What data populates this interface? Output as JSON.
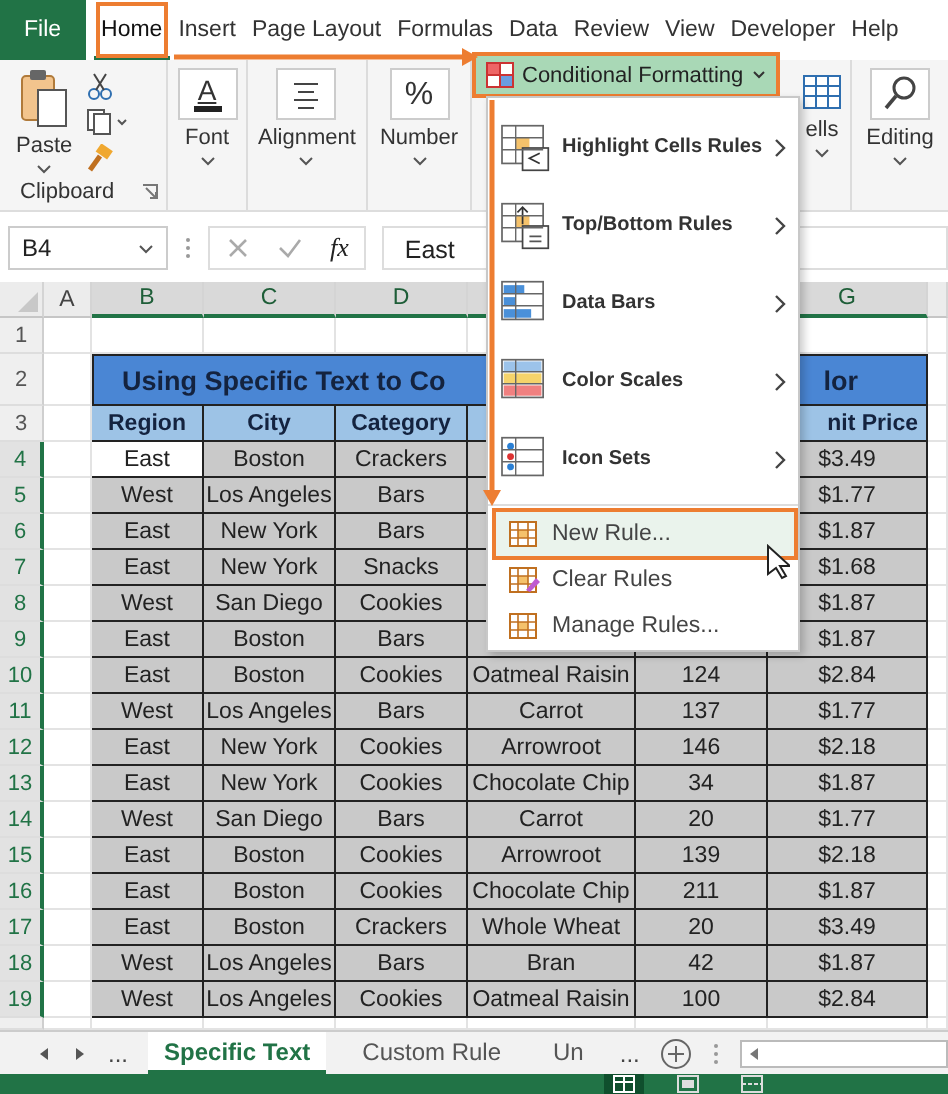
{
  "ribbon_tabs": [
    {
      "label": "File",
      "kind": "file",
      "selected": false,
      "marked": false
    },
    {
      "label": "Home",
      "kind": "tab",
      "selected": true,
      "marked": true
    },
    {
      "label": "Insert",
      "kind": "tab",
      "selected": false,
      "marked": false
    },
    {
      "label": "Page Layout",
      "kind": "tab",
      "selected": false,
      "marked": false
    },
    {
      "label": "Formulas",
      "kind": "tab",
      "selected": false,
      "marked": false
    },
    {
      "label": "Data",
      "kind": "tab",
      "selected": false,
      "marked": false
    },
    {
      "label": "Review",
      "kind": "tab",
      "selected": false,
      "marked": false
    },
    {
      "label": "View",
      "kind": "tab",
      "selected": false,
      "marked": false
    },
    {
      "label": "Developer",
      "kind": "tab",
      "selected": false,
      "marked": false
    },
    {
      "label": "Help",
      "kind": "tab",
      "selected": false,
      "marked": false
    }
  ],
  "ribbon": {
    "paste": "Paste",
    "clipboard": "Clipboard",
    "font_glyph": "A",
    "font": "Font",
    "alignment": "Alignment",
    "number_glyph": "%",
    "number": "Number",
    "conditional_formatting": {
      "label": "Conditional Formatting",
      "marked": true
    },
    "cells": "ells",
    "editing": "Editing"
  },
  "formula_bar": {
    "name_box": "B4",
    "fx": "fx",
    "value": "East"
  },
  "sheet": {
    "columns_left": [
      "A",
      "B",
      "C",
      "D"
    ],
    "columns_right": [
      "G"
    ],
    "blank_row": "1",
    "title_row": {
      "number": "2",
      "parts": [
        "Using Specific Text to Co",
        "lor"
      ]
    },
    "header_row": {
      "number": "3",
      "cells": [
        "Region",
        "City",
        "Category"
      ],
      "unit_price": "nit Price"
    },
    "rows": [
      {
        "number": "4",
        "active": true,
        "cells": [
          "East",
          "Boston",
          "Crackers"
        ],
        "unit_price": "$3.49"
      },
      {
        "number": "5",
        "active": false,
        "cells": [
          "West",
          "Los Angeles",
          "Bars"
        ],
        "unit_price": "$1.77"
      },
      {
        "number": "6",
        "active": false,
        "cells": [
          "East",
          "New York",
          "Bars"
        ],
        "unit_price": "$1.87"
      },
      {
        "number": "7",
        "active": false,
        "cells": [
          "East",
          "New York",
          "Snacks"
        ],
        "unit_price": "$1.68"
      },
      {
        "number": "8",
        "active": false,
        "cells": [
          "West",
          "San Diego",
          "Cookies"
        ],
        "unit_price": "$1.87"
      },
      {
        "number": "9",
        "active": false,
        "cells": [
          "East",
          "Boston",
          "Bars"
        ],
        "unit_price": "$1.87"
      },
      {
        "number": "10",
        "active": false,
        "cells": [
          "East",
          "Boston",
          "Cookies",
          "Oatmeal Raisin",
          "124"
        ],
        "unit_price": "$2.84"
      },
      {
        "number": "11",
        "active": false,
        "cells": [
          "West",
          "Los Angeles",
          "Bars",
          "Carrot",
          "137"
        ],
        "unit_price": "$1.77"
      },
      {
        "number": "12",
        "active": false,
        "cells": [
          "East",
          "New York",
          "Cookies",
          "Arrowroot",
          "146"
        ],
        "unit_price": "$2.18"
      },
      {
        "number": "13",
        "active": false,
        "cells": [
          "East",
          "New York",
          "Cookies",
          "Chocolate Chip",
          "34"
        ],
        "unit_price": "$1.87"
      },
      {
        "number": "14",
        "active": false,
        "cells": [
          "West",
          "San Diego",
          "Bars",
          "Carrot",
          "20"
        ],
        "unit_price": "$1.77"
      },
      {
        "number": "15",
        "active": false,
        "cells": [
          "East",
          "Boston",
          "Cookies",
          "Arrowroot",
          "139"
        ],
        "unit_price": "$2.18"
      },
      {
        "number": "16",
        "active": false,
        "cells": [
          "East",
          "Boston",
          "Cookies",
          "Chocolate Chip",
          "211"
        ],
        "unit_price": "$1.87"
      },
      {
        "number": "17",
        "active": false,
        "cells": [
          "East",
          "Boston",
          "Crackers",
          "Whole Wheat",
          "20"
        ],
        "unit_price": "$3.49"
      },
      {
        "number": "18",
        "active": false,
        "cells": [
          "West",
          "Los Angeles",
          "Bars",
          "Bran",
          "42"
        ],
        "unit_price": "$1.87"
      },
      {
        "number": "19",
        "active": false,
        "cells": [
          "West",
          "Los Angeles",
          "Cookies",
          "Oatmeal Raisin",
          "100"
        ],
        "unit_price": "$2.84"
      }
    ]
  },
  "menu": {
    "items": [
      {
        "kind": "submenu",
        "label": "Highlight Cells Rules",
        "selected": false,
        "marked": false
      },
      {
        "kind": "submenu",
        "label": "Top/Bottom Rules",
        "selected": false,
        "marked": false
      },
      {
        "kind": "submenu",
        "label": "Data Bars",
        "selected": false,
        "marked": false
      },
      {
        "kind": "submenu",
        "label": "Color Scales",
        "selected": false,
        "marked": false
      },
      {
        "kind": "submenu",
        "label": "Icon Sets",
        "selected": false,
        "marked": false
      },
      {
        "kind": "command",
        "label": "New Rule...",
        "selected": true,
        "marked": true
      },
      {
        "kind": "command",
        "label": "Clear Rules",
        "selected": false,
        "marked": false
      },
      {
        "kind": "command",
        "label": "Manage Rules...",
        "selected": false,
        "marked": false
      }
    ]
  },
  "sheet_tabs": {
    "more_left": "...",
    "tabs": [
      {
        "label": "Specific Text",
        "selected": true
      },
      {
        "label": "Custom Rule",
        "selected": false
      },
      {
        "label": "Un",
        "selected": false
      }
    ],
    "more_right": "..."
  }
}
